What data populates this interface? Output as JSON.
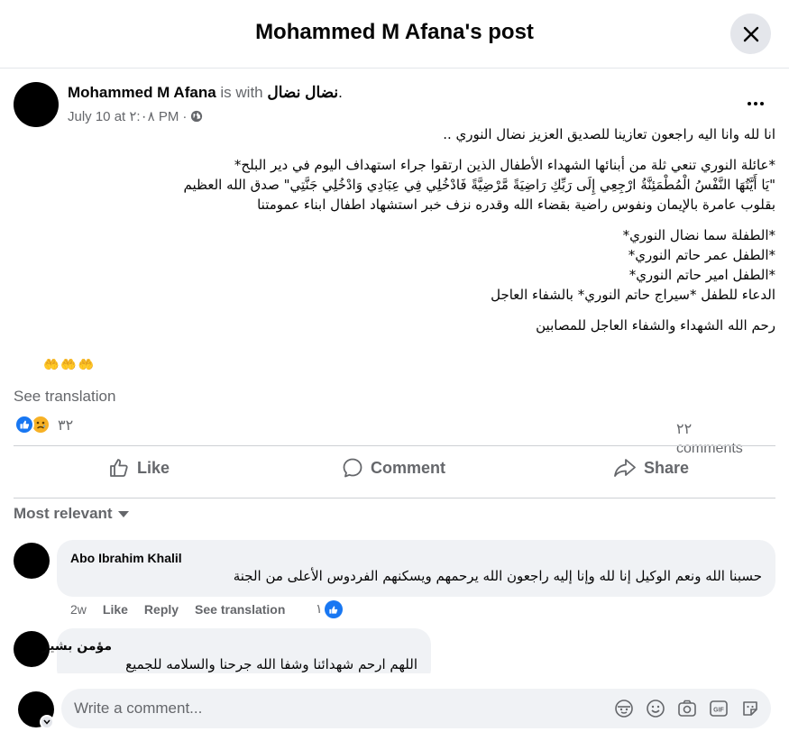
{
  "header": {
    "title": "Mohammed M Afana's post"
  },
  "post": {
    "author": "Mohammed M Afana",
    "with_text": " is with ",
    "tagged": "نضال نضال",
    "tagged_suffix": ".",
    "date": "July 10 at ٢:٠٨ PM",
    "separator": "·",
    "body": [
      "انا لله وانا اليه راجعون تعازينا للصديق العزيز نضال النوري ..",
      "",
      "*عائلة النوري تنعي ثلة من أبنائها الشهداء الأطفال الذين ارتقوا جراء استهداف اليوم في دير البلح*",
      "\"يَا أَيَّتُهَا النَّفْسُ الْمُطْمَئِنَّةُ ارْجِعِي إِلَى رَبِّكِ رَاضِيَةً مَّرْضِيَّةً فَادْخُلِي فِي عِبَادِي وَادْخُلِي جَنَّتِي\" صدق الله العظيم",
      "بقلوب عامرة بالإيمان ونفوس راضية بقضاء الله وقدره نزف خبر استشهاد اطفال ابناء عمومتنا",
      "",
      "*الطفلة سما نضال النوري*",
      "*الطفل عمر حاتم النوري*",
      "*الطفل امير حاتم النوري*",
      "الدعاء للطفل *سيراج حاتم النوري* بالشفاء العاجل",
      "",
      "رحم الله الشهداء والشفاء العاجل للمصابين"
    ],
    "emojis": "🤲🤲🤲",
    "see_translation": "See translation",
    "reactions_count": "٣٢",
    "comments_count": "٢٢",
    "comments_label": "comments"
  },
  "actions": {
    "like": "Like",
    "comment": "Comment",
    "share": "Share"
  },
  "sort_label": "Most relevant",
  "comments": [
    {
      "author": "Abo Ibrahim Khalil",
      "text": "حسبنا الله ونعم الوكيل إنا لله وإنا إليه راجعون الله يرحمهم ويسكنهم الفردوس الأعلى من الجنة",
      "time": "2w",
      "like": "Like",
      "reply": "Reply",
      "see_translation": "See translation",
      "likes": "١"
    },
    {
      "author": "مؤمن بشير",
      "text": "اللهم ارحم شهدائنا وشفا الله جرحنا والسلامه للجميع"
    }
  ],
  "composer": {
    "placeholder": "Write a comment..."
  },
  "colors": {
    "accent": "#1877f2",
    "muted": "#65676b",
    "bubble": "#f0f2f5"
  }
}
